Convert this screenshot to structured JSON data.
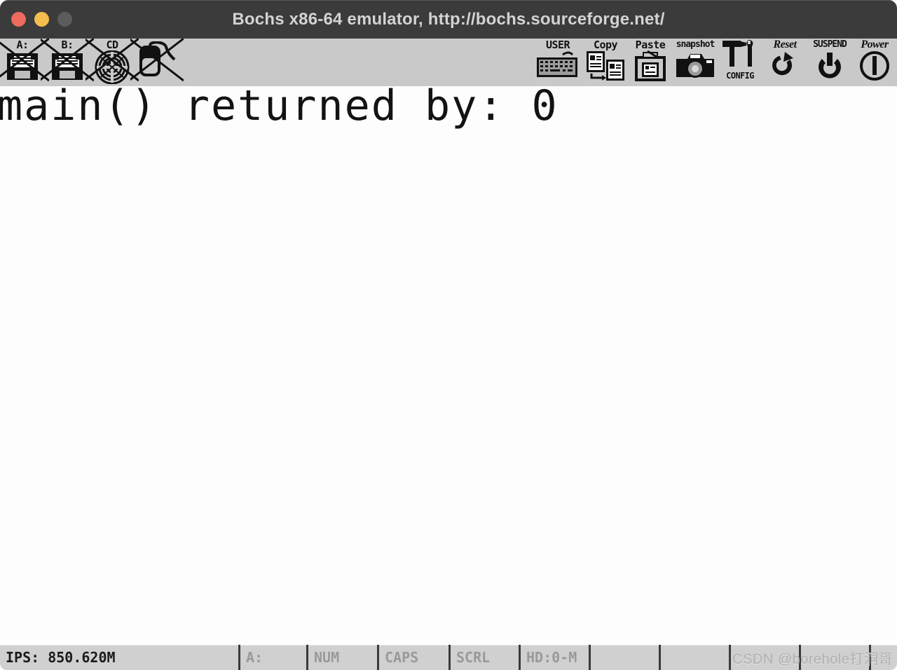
{
  "window": {
    "title": "Bochs x86-64 emulator, http://bochs.sourceforge.net/",
    "controls": [
      {
        "name": "close",
        "color": "#ec6a5e"
      },
      {
        "name": "minimize",
        "color": "#f5bd4f"
      },
      {
        "name": "maximize",
        "color": "#5c5c5c"
      }
    ],
    "titlebar_bg": "#3b3b3b",
    "titlebar_fg": "#d3d3d3"
  },
  "toolbar": {
    "bg": "#c9c9c9",
    "left_items": [
      {
        "label": "A:",
        "icon": "floppy-a-icon",
        "disabled": true
      },
      {
        "label": "B:",
        "icon": "floppy-b-icon",
        "disabled": true
      },
      {
        "label": "CD",
        "icon": "cdrom-icon",
        "disabled": true
      },
      {
        "label": "",
        "icon": "mouse-icon",
        "disabled": true
      }
    ],
    "right_items": [
      {
        "label": "USER",
        "icon": "keyboard-icon",
        "sublabel": ""
      },
      {
        "label": "Copy",
        "icon": "copy-icon",
        "sublabel": ""
      },
      {
        "label": "Paste",
        "icon": "paste-icon",
        "sublabel": ""
      },
      {
        "label": "snapshot",
        "icon": "camera-icon",
        "sublabel": ""
      },
      {
        "label": "",
        "icon": "config-icon",
        "sublabel": "CONFIG"
      },
      {
        "label": "Reset",
        "icon": "reset-icon",
        "sublabel": ""
      },
      {
        "label": "SUSPEND",
        "icon": "suspend-icon",
        "sublabel": ""
      },
      {
        "label": "Power",
        "icon": "power-icon",
        "sublabel": ""
      }
    ]
  },
  "screen": {
    "bg": "#fdfdfd",
    "fg": "#131313",
    "line": "main() returned by: 0"
  },
  "statusbar": {
    "bg": "#d0d0d0",
    "ips": "IPS: 850.620M",
    "cells": [
      {
        "label": "A:",
        "active": false
      },
      {
        "label": "NUM",
        "active": false
      },
      {
        "label": "CAPS",
        "active": false
      },
      {
        "label": "SCRL",
        "active": false
      },
      {
        "label": "HD:0-M",
        "active": false
      },
      {
        "label": "",
        "active": false
      },
      {
        "label": "",
        "active": false
      },
      {
        "label": "",
        "active": false
      },
      {
        "label": "",
        "active": false
      },
      {
        "label": "",
        "active": false
      }
    ],
    "watermark": "CSDN @borehole打洞哥"
  }
}
